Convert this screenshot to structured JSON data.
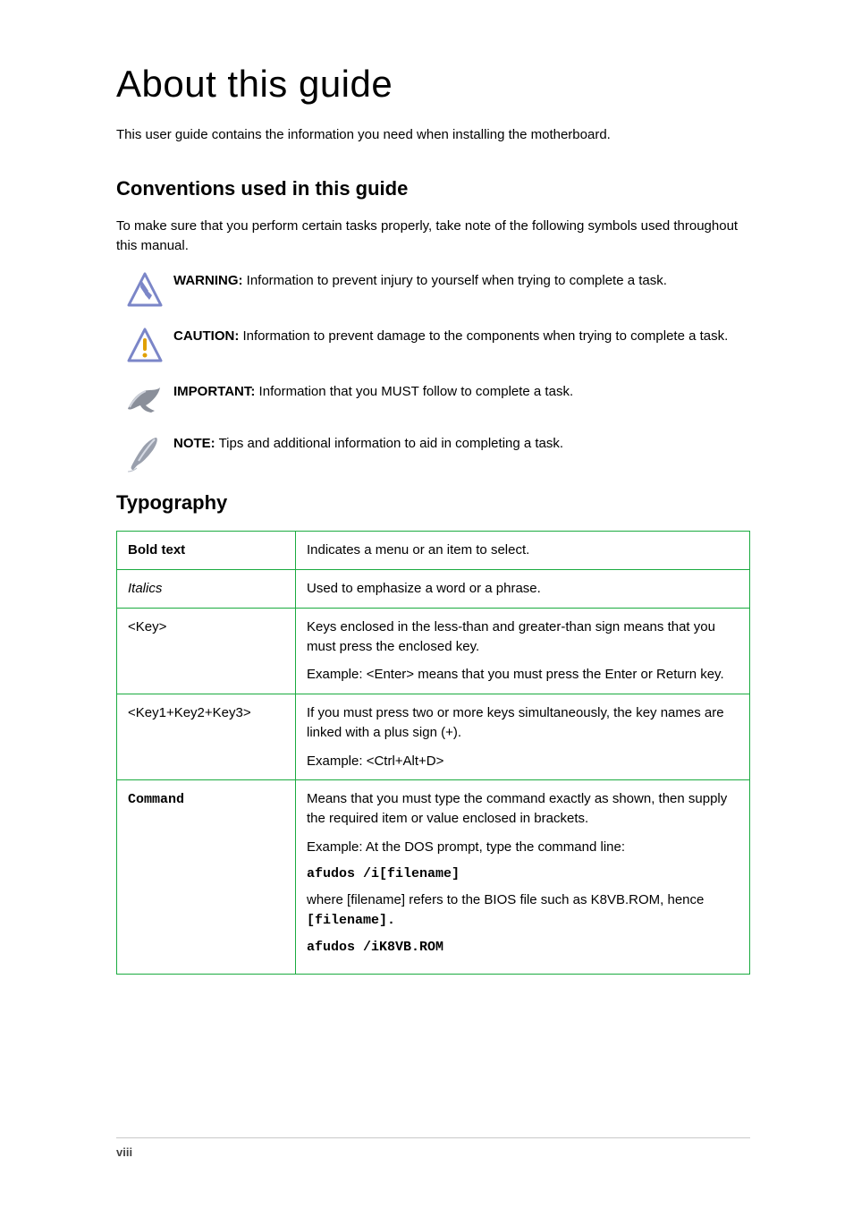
{
  "title": "About this guide",
  "lead": "This user guide contains the information you need when installing the motherboard.",
  "sections": {
    "conventions_heading": "Conventions used in this guide",
    "conventions_intro": "To make sure that you perform certain tasks properly, take note of the following symbols used throughout this manual.",
    "typography_heading": "Typography"
  },
  "conventions": [
    {
      "label": "WARNING:",
      "text": " Information to prevent injury to yourself when trying to complete a task."
    },
    {
      "label": "CAUTION:",
      "text": " Information to prevent damage to the components when trying to complete a task."
    },
    {
      "label": "IMPORTANT:",
      "text": " Information that you MUST follow to complete a task."
    },
    {
      "label": "NOTE:",
      "text": " Tips and additional information to aid in completing a task."
    }
  ],
  "typography": [
    {
      "k": "Bold text",
      "k_cls": "bold",
      "v": "Indicates a menu or an item to select."
    },
    {
      "k": "Italics",
      "k_cls": "ital",
      "v": "Used to emphasize a word or a phrase."
    },
    {
      "k": "<Key>",
      "k_cls": "",
      "v": "Keys enclosed in the less-than and greater-than sign means that you must press the enclosed key.",
      "ex": "Example: <Enter> means that you must press the Enter or Return key."
    },
    {
      "k": "<Key1+Key2+Key3>",
      "k_cls": "",
      "v": "If you must press two or more keys simultaneously, the key names are linked with a plus sign (+).",
      "ex": "Example: <Ctrl+Alt+D>"
    }
  ],
  "command": {
    "k": "Command",
    "v": "Means that you must type the command exactly as shown, then supply the required item or value enclosed in brackets.",
    "ex1_pre": "Example: At the DOS prompt, type the command line:",
    "ex1_cmd": "afudos /i[filename]",
    "ex2_pre": "where [filename] refers to the BIOS file such as K8VB.ROM, hence",
    "ex2_bracket": "[filename].",
    "ex2_cmd": "afudos /iK8VB.ROM"
  },
  "footer": {
    "page": "viii",
    "text": ""
  }
}
